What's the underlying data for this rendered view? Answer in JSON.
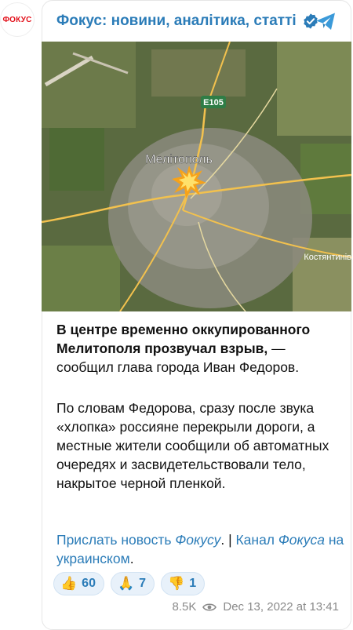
{
  "avatar": {
    "label": "ФОКУС"
  },
  "header": {
    "channel_title": "Фокус: новини, аналітика, статті"
  },
  "map": {
    "city_label": "Мелітополь",
    "road_label": "E105",
    "edge_label": "Костянтинів"
  },
  "message": {
    "p1_bold": "В центре временно оккупированного Мелитополя прозвучал взрыв,",
    "p1_rest": " — сообщил глава города Иван Федоров.",
    "p2": "По словам Федорова, сразу после звука «хлопка» россияне перекрыли дороги, а местные жители сообщили об автоматных очередях и засвидетельствовали тело, накрытое черной пленкой.",
    "link1_a": "Прислать новость ",
    "link1_b": "Фокусу",
    "separator": ". | ",
    "link2_a": "Канал ",
    "link2_b": "Фокуса",
    "link2_c": " на украинском",
    "end": "."
  },
  "reactions": [
    {
      "emoji": "👍",
      "icon": "thumbs-up-icon",
      "count": "60"
    },
    {
      "emoji": "🙏",
      "icon": "praying-hands-icon",
      "count": "7"
    },
    {
      "emoji": "👎",
      "icon": "thumbs-down-icon",
      "count": "1"
    }
  ],
  "footer": {
    "views": "8.5K",
    "timestamp": "Dec 13, 2022 at 13:41"
  },
  "colors": {
    "link": "#2b7cb8",
    "reaction_bg": "#e8f1fa",
    "brand_red": "#e3101a"
  }
}
